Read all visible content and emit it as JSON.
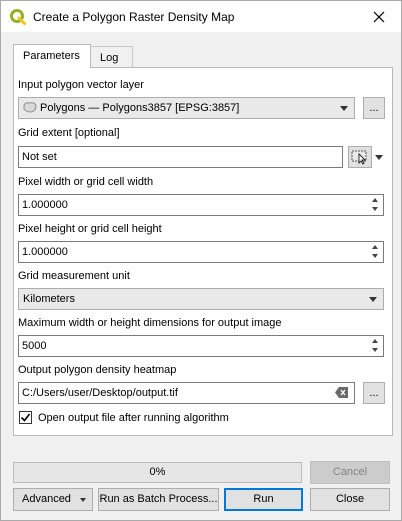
{
  "window": {
    "title": "Create a Polygon Raster Density Map"
  },
  "tabs": [
    {
      "label": "Parameters",
      "active": true
    },
    {
      "label": "Log",
      "active": false
    }
  ],
  "params": {
    "input_layer": {
      "label": "Input polygon vector layer",
      "value": "Polygons — Polygons3857 [EPSG:3857]",
      "more_label": "..."
    },
    "grid_extent": {
      "label": "Grid extent [optional]",
      "value": "Not set"
    },
    "pixel_width": {
      "label": "Pixel width or grid cell width",
      "value": "1.000000"
    },
    "pixel_height": {
      "label": "Pixel height or grid cell height",
      "value": "1.000000"
    },
    "grid_unit": {
      "label": "Grid measurement unit",
      "value": "Kilometers"
    },
    "max_dim": {
      "label": "Maximum width or height dimensions for output image",
      "value": "5000"
    },
    "output": {
      "label": "Output polygon density heatmap",
      "value": "C:/Users/user/Desktop/output.tif",
      "more_label": "..."
    },
    "open_after": {
      "label": "Open output file after running algorithm",
      "checked": true
    }
  },
  "progress": {
    "percent_text": "0%",
    "value": 0
  },
  "buttons": {
    "cancel": "Cancel",
    "advanced": "Advanced",
    "batch": "Run as Batch Process...",
    "run": "Run",
    "close": "Close"
  },
  "colors": {
    "accent": "#0078d7",
    "qgis_green": "#93b023",
    "qgis_yellow": "#f0c419"
  }
}
